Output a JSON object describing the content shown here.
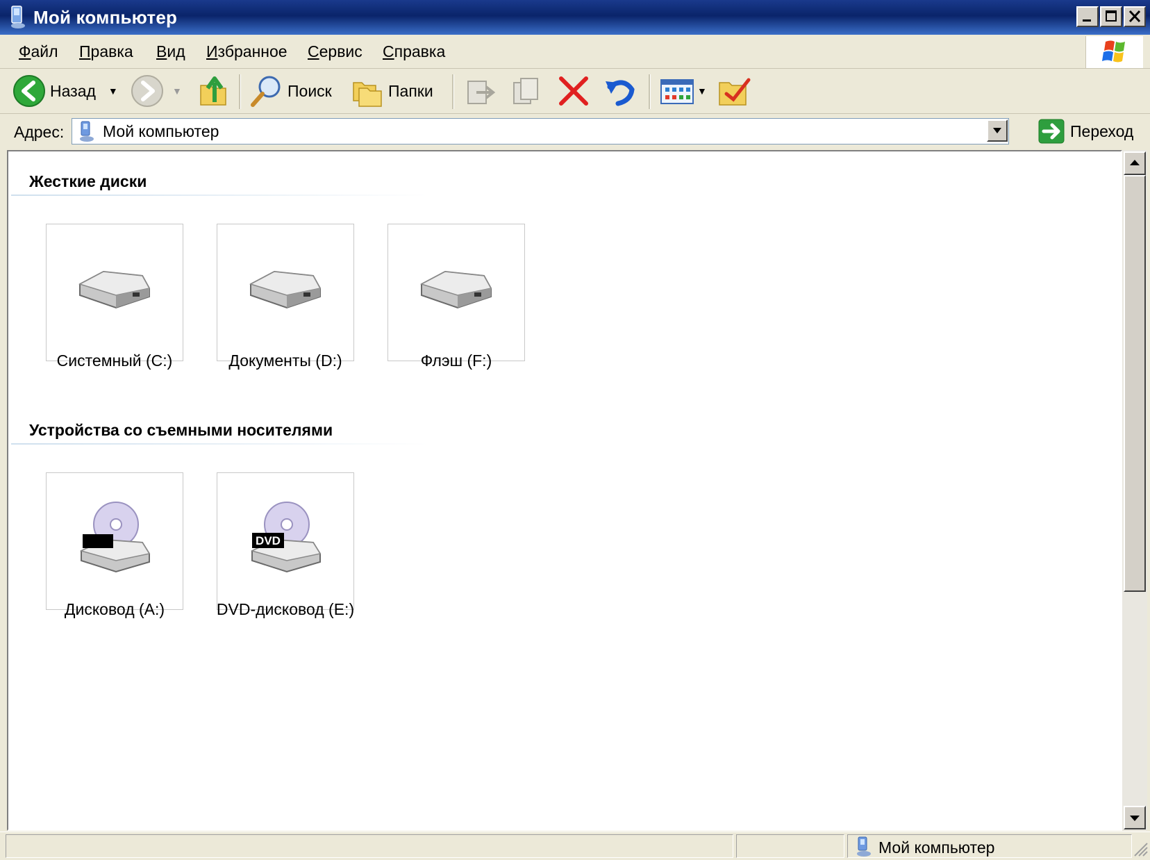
{
  "window": {
    "title": "Мой компьютер"
  },
  "menu": {
    "items": [
      "Файл",
      "Правка",
      "Вид",
      "Избранное",
      "Сервис",
      "Справка"
    ]
  },
  "toolbar": {
    "back_label": "Назад",
    "search_label": "Поиск",
    "folders_label": "Папки"
  },
  "address": {
    "label": "Адрес:",
    "value": "Мой компьютер",
    "go_label": "Переход"
  },
  "groups": [
    {
      "title": "Жесткие диски",
      "items": [
        {
          "label": "Системный (C:)",
          "icon": "hard-drive-icon"
        },
        {
          "label": "Документы (D:)",
          "icon": "hard-drive-icon"
        },
        {
          "label": "Флэш (F:)",
          "icon": "hard-drive-icon"
        }
      ]
    },
    {
      "title": "Устройства со съемными носителями",
      "items": [
        {
          "label": "Дисковод (A:)",
          "icon": "floppy-drive-icon"
        },
        {
          "label": "DVD-дисковод (E:)",
          "icon": "dvd-drive-icon",
          "badge": "DVD"
        }
      ]
    }
  ],
  "status": {
    "location": "Мой компьютер"
  },
  "colors": {
    "titlebar": "#0a246a",
    "chrome": "#ece9d8",
    "delete_red": "#e02020",
    "undo_blue": "#1a5ad0",
    "go_green": "#2e9e3e"
  }
}
